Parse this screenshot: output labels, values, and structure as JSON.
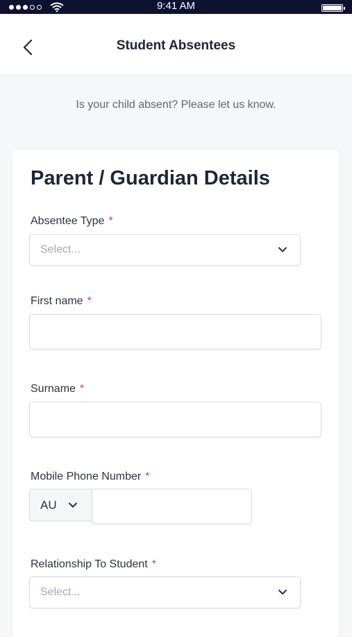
{
  "status_bar": {
    "time": "9:41 AM"
  },
  "nav": {
    "title": "Student Absentees",
    "back_icon": "chevron-left-icon"
  },
  "intro_text": "Is your child absent? Please let us know.",
  "form": {
    "title": "Parent / Guardian Details",
    "required_marker": "*",
    "absentee_type": {
      "label": "Absentee Type",
      "placeholder": "Select..."
    },
    "first_name": {
      "label": "First name",
      "value": ""
    },
    "surname": {
      "label": "Surname",
      "value": ""
    },
    "mobile_phone": {
      "label": "Mobile Phone Number",
      "country_code": "AU",
      "value": ""
    },
    "relationship": {
      "label": "Relationship To Student",
      "placeholder": "Select..."
    }
  },
  "colors": {
    "status_bar": "#0e1130",
    "required": "#e0364e",
    "placeholder": "#a4a9b4",
    "background": "#f6f7f9"
  }
}
